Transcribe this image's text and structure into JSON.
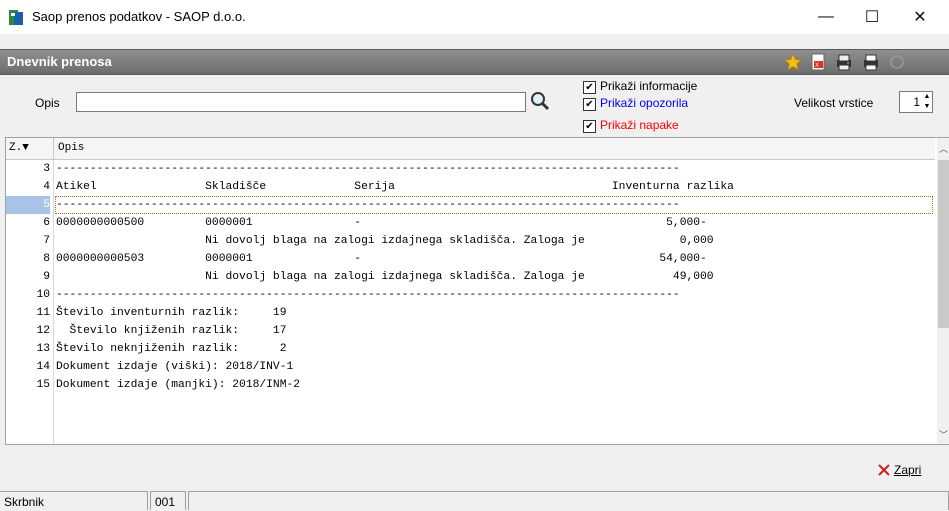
{
  "window": {
    "title": "Saop prenos podatkov - SAOP d.o.o.",
    "minimize": "—",
    "maximize": "☐",
    "close": "✕"
  },
  "section": {
    "title": "Dnevnik prenosa",
    "toolbar_icons": [
      "star-icon",
      "pdf-export-icon",
      "print-preview-icon",
      "print-icon",
      "disabled-tool-icon"
    ]
  },
  "filter": {
    "opis_label": "Opis",
    "opis_value": "",
    "checkboxes": [
      {
        "label": "Prikaži informacije",
        "checked": true,
        "color": "#000000"
      },
      {
        "label": "Prikaži opozorila",
        "checked": true,
        "color": "#0000ff"
      },
      {
        "label": "Prikaži napake",
        "checked": true,
        "color": "#ff0000"
      }
    ],
    "velikost_label": "Velikost vrstice",
    "velikost_value": "1"
  },
  "grid": {
    "columns": [
      "Z.",
      "Opis"
    ],
    "sort_indicator": "▼",
    "rows": [
      {
        "n": "3",
        "text": "--------------------------------------------------------------------------------------------"
      },
      {
        "n": "4",
        "text": "Atikel                Skladišče             Serija                                Inventurna razlika"
      },
      {
        "n": "5",
        "text": "--------------------------------------------------------------------------------------------",
        "selected": true
      },
      {
        "n": "6",
        "text": "0000000000500         0000001               -                                             5,000-"
      },
      {
        "n": "7",
        "text": "                      Ni dovolj blaga na zalogi izdajnega skladišča. Zaloga je              0,000"
      },
      {
        "n": "8",
        "text": "0000000000503         0000001               -                                            54,000-"
      },
      {
        "n": "9",
        "text": "                      Ni dovolj blaga na zalogi izdajnega skladišča. Zaloga je             49,000"
      },
      {
        "n": "10",
        "text": "--------------------------------------------------------------------------------------------"
      },
      {
        "n": "11",
        "text": "Število inventurnih razlik:     19"
      },
      {
        "n": "12",
        "text": "  Število knjiženih razlik:     17"
      },
      {
        "n": "13",
        "text": "Število neknjiženih razlik:      2"
      },
      {
        "n": "14",
        "text": "Dokument izdaje (viški): 2018/INV-1"
      },
      {
        "n": "15",
        "text": "Dokument izdaje (manjki): 2018/INM-2"
      }
    ]
  },
  "footer": {
    "zapri_label": "Zapri"
  },
  "status": {
    "user": "Skrbnik",
    "code": "001",
    "extra": ""
  }
}
